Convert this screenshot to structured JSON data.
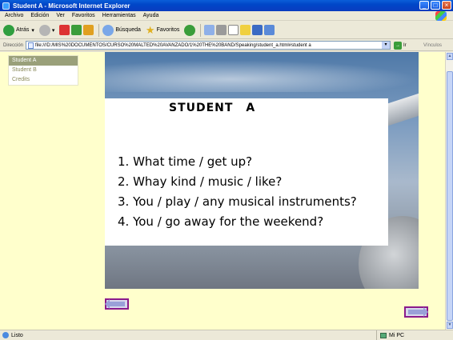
{
  "window": {
    "title": "Student A - Microsoft Internet Explorer"
  },
  "menu": [
    "Archivo",
    "Edición",
    "Ver",
    "Favoritos",
    "Herramientas",
    "Ayuda"
  ],
  "toolbar": {
    "back_label": "Atrás",
    "search_label": "Búsqueda",
    "favorites_label": "Favoritos"
  },
  "address": {
    "label": "Dirección",
    "url": "file:///D:/MIS%20DOCUMENTOS/CURSO%20MALTED%20AVANZADO/1%20THE%20BAND/Speaking/student_a.html#student a",
    "go_label": "Ir",
    "links_label": "Vínculos"
  },
  "sidenav": [
    "Student A",
    "Student B",
    "Credits"
  ],
  "card": {
    "title": "STUDENT   A",
    "questions": [
      "1. What time / get up?",
      "2. Whay kind / music / like?",
      "3. You / play / any musical instruments?",
      "4. You / go away for the weekend?"
    ]
  },
  "status": {
    "left": "Listo",
    "right": "Mi PC"
  },
  "colors": {
    "page_bg": "#ffffcc",
    "active_nav": "#9aa07a",
    "nav_border": "#8b1a8b"
  }
}
